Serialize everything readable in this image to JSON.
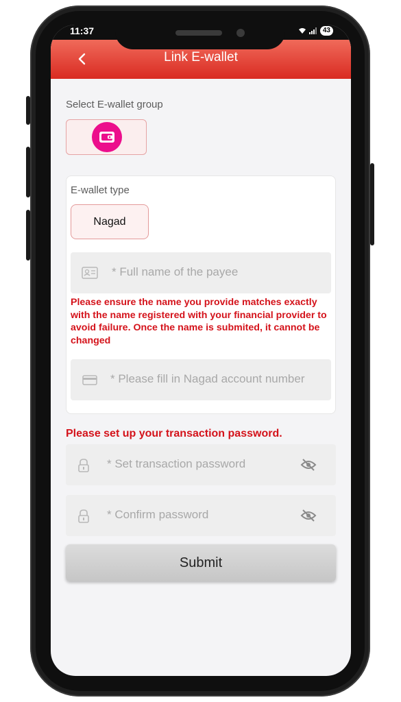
{
  "status": {
    "time": "11:37",
    "battery": "43"
  },
  "header": {
    "title": "Link E-wallet"
  },
  "group": {
    "label": "Select E-wallet group"
  },
  "wallet_type": {
    "label": "E-wallet type",
    "selected": "Nagad"
  },
  "payee": {
    "placeholder": "* Full name of the payee",
    "warning": "Please ensure the name you provide matches exactly with the name registered with your financial provider to avoid failure. Once the name is submited, it cannot be changed"
  },
  "account": {
    "placeholder": "* Please fill in Nagad account number"
  },
  "password_section": {
    "title": "Please set up your transaction password.",
    "set_placeholder": "* Set transaction password",
    "confirm_placeholder": "* Confirm password"
  },
  "submit_label": "Submit",
  "colors": {
    "header": "#d92b22",
    "warning": "#d4121a",
    "wallet_icon": "#ec0e8c"
  }
}
